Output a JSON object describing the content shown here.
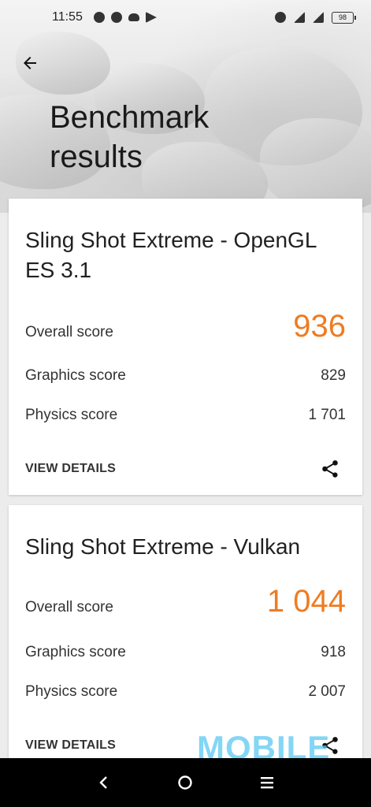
{
  "status_bar": {
    "time": "11:55",
    "battery": "98"
  },
  "header": {
    "title": "Benchmark results"
  },
  "results": [
    {
      "test_name": "Sling Shot Extreme - OpenGL ES 3.1",
      "overall_label": "Overall score",
      "overall_value": "936",
      "graphics_label": "Graphics score",
      "graphics_value": "829",
      "physics_label": "Physics score",
      "physics_value": "1 701",
      "view_details_label": "VIEW DETAILS"
    },
    {
      "test_name": "Sling Shot Extreme - Vulkan",
      "overall_label": "Overall score",
      "overall_value": "1 044",
      "graphics_label": "Graphics score",
      "graphics_value": "918",
      "physics_label": "Physics score",
      "physics_value": "2 007",
      "view_details_label": "VIEW DETAILS"
    }
  ],
  "watermark": "MOBILE",
  "colors": {
    "accent": "#ef7c22",
    "nav_bar": "#000000"
  }
}
